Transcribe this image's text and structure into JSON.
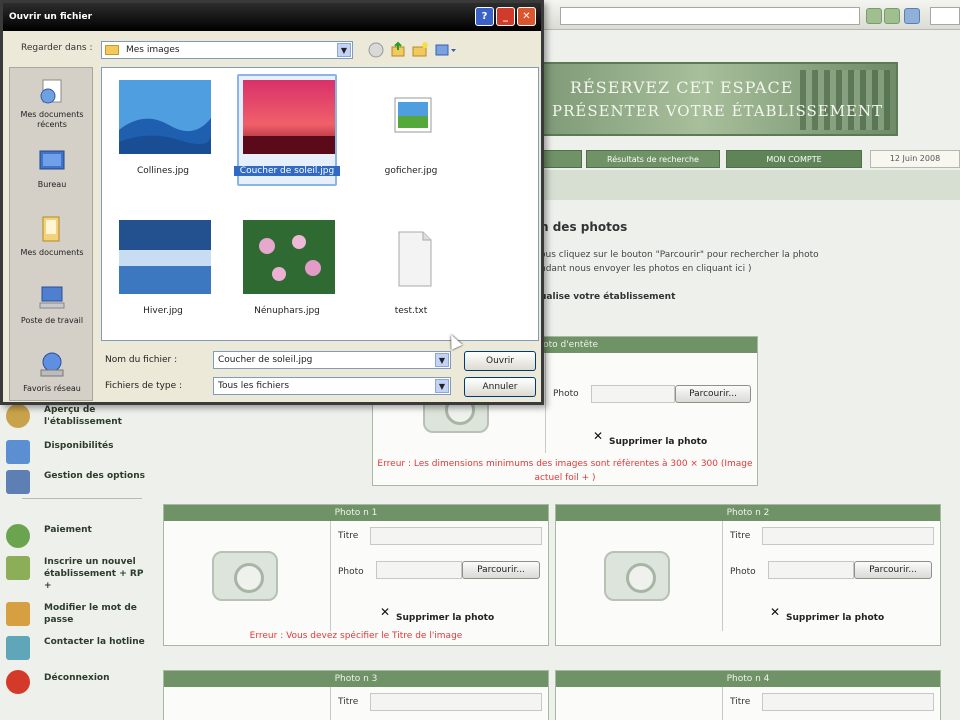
{
  "dialog": {
    "title": "Ouvrir un fichier",
    "lookin_label": "Regarder dans :",
    "lookin_value": "Mes images",
    "places": [
      {
        "label": "Mes documents récents",
        "icon": "recent-documents-icon"
      },
      {
        "label": "Bureau",
        "icon": "desktop-icon"
      },
      {
        "label": "Mes documents",
        "icon": "my-documents-icon"
      },
      {
        "label": "Poste de travail",
        "icon": "my-computer-icon"
      },
      {
        "label": "Favoris réseau",
        "icon": "network-places-icon"
      }
    ],
    "files": [
      {
        "name": "Collines.jpg",
        "icon": "hills-thumbnail",
        "selected": false
      },
      {
        "name": "Coucher de soleil.jpg",
        "icon": "sunset-thumbnail",
        "selected": true
      },
      {
        "name": "goficher.jpg",
        "icon": "image-file-icon",
        "selected": false
      },
      {
        "name": "Hiver.jpg",
        "icon": "winter-thumbnail",
        "selected": false
      },
      {
        "name": "Nénuphars.jpg",
        "icon": "waterlilies-thumbnail",
        "selected": false
      },
      {
        "name": "test.txt",
        "icon": "text-file-icon",
        "selected": false
      }
    ],
    "filename_label": "Nom du fichier :",
    "filename_value": "Coucher de soleil.jpg",
    "filetype_label": "Fichiers de type :",
    "filetype_value": "Tous les fichiers",
    "open_label": "Ouvrir",
    "cancel_label": "Annuler"
  },
  "page": {
    "banner_line1": "RÉSERVEZ CET ESPACE",
    "banner_line2": "PRÉSENTER VOTRE ÉTABLISSEMENT",
    "nav": [
      "",
      "Résultats de recherche",
      "MON COMPTE"
    ],
    "date": "12 Juin 2008",
    "section_title": "n des photos",
    "section_text1": "ous cliquez sur le bouton \"Parcourir\" pour rechercher la photo",
    "section_text2": "ndant nous envoyer les photos en cliquant ici )",
    "section_sub": "ualise votre établissement",
    "menu": [
      {
        "label": "Aperçu de l'établissement",
        "color": "#c9a34b"
      },
      {
        "label": "Disponibilités",
        "color": "#5b8fd1"
      },
      {
        "label": "Gestion des options",
        "color": "#5e7fb3"
      },
      {
        "label": "Paiement",
        "color": "#6aa44e"
      },
      {
        "label": "Inscrire un nouvel établissement + RP +",
        "color": "#8cae58"
      },
      {
        "label": "Modifier le mot de passe",
        "color": "#d6a042"
      },
      {
        "label": "Contacter la hotline",
        "color": "#5fa6b8"
      },
      {
        "label": "Déconnexion",
        "color": "#d33a2a"
      }
    ],
    "panels": {
      "main": {
        "title": "Photo d'entête",
        "photo_label": "Photo",
        "browse_label": "Parcourir...",
        "delete_label": "Supprimer la photo",
        "error": "Erreur : Les dimensions minimums des images sont réfèrentes à 300 × 300 (Image actuel foil + )"
      },
      "p1": {
        "title": "Photo n 1",
        "title_label": "Titre",
        "photo_label": "Photo",
        "browse_label": "Parcourir...",
        "delete_label": "Supprimer la photo",
        "error": "Erreur : Vous devez spécifier le Titre de l'image"
      },
      "p2": {
        "title": "Photo n 2",
        "title_label": "Titre",
        "photo_label": "Photo",
        "browse_label": "Parcourir...",
        "delete_label": "Supprimer la photo"
      },
      "p3": {
        "title": "Photo n 3",
        "title_label": "Titre"
      },
      "p4": {
        "title": "Photo n 4",
        "title_label": "Titre"
      }
    }
  }
}
